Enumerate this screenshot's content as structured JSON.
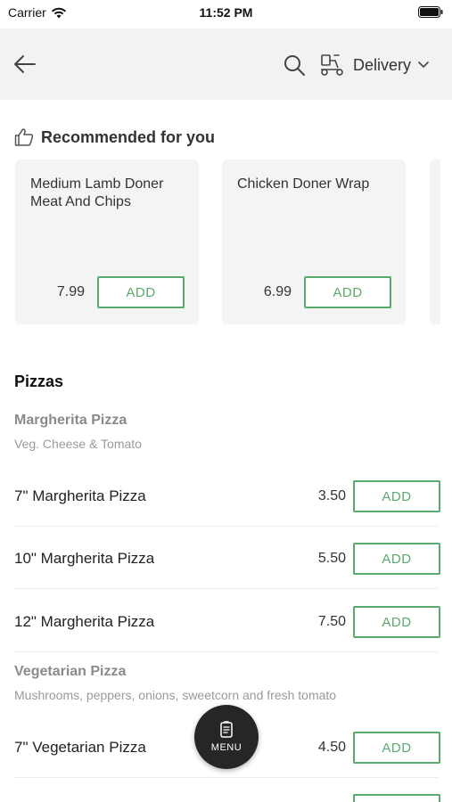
{
  "status_bar": {
    "carrier": "Carrier",
    "time": "11:52 PM"
  },
  "header": {
    "delivery_label": "Delivery"
  },
  "recommended": {
    "title": "Recommended for you",
    "cards": [
      {
        "name": "Medium Lamb Doner Meat And Chips",
        "price": "7.99",
        "add_label": "ADD"
      },
      {
        "name": "Chicken Doner Wrap",
        "price": "6.99",
        "add_label": "ADD"
      }
    ]
  },
  "menu": {
    "section_title": "Pizzas",
    "groups": [
      {
        "title": "Margherita Pizza",
        "description": "Veg. Cheese & Tomato",
        "items": [
          {
            "name": "7\" Margherita Pizza",
            "price": "3.50",
            "add_label": "ADD"
          },
          {
            "name": "10\" Margherita Pizza",
            "price": "5.50",
            "add_label": "ADD"
          },
          {
            "name": "12\" Margherita Pizza",
            "price": "7.50",
            "add_label": "ADD"
          }
        ]
      },
      {
        "title": "Vegetarian Pizza",
        "description": "Mushrooms, peppers, onions, sweetcorn and fresh tomato",
        "items": [
          {
            "name": "7\" Vegetarian Pizza",
            "price": "4.50",
            "add_label": "ADD"
          }
        ]
      }
    ]
  },
  "fab": {
    "label": "MENU"
  },
  "colors": {
    "accent_green": "#5aa96d",
    "header_bg": "#f2f2f2",
    "card_bg": "#f4f4f4",
    "fab_bg": "#262626"
  }
}
